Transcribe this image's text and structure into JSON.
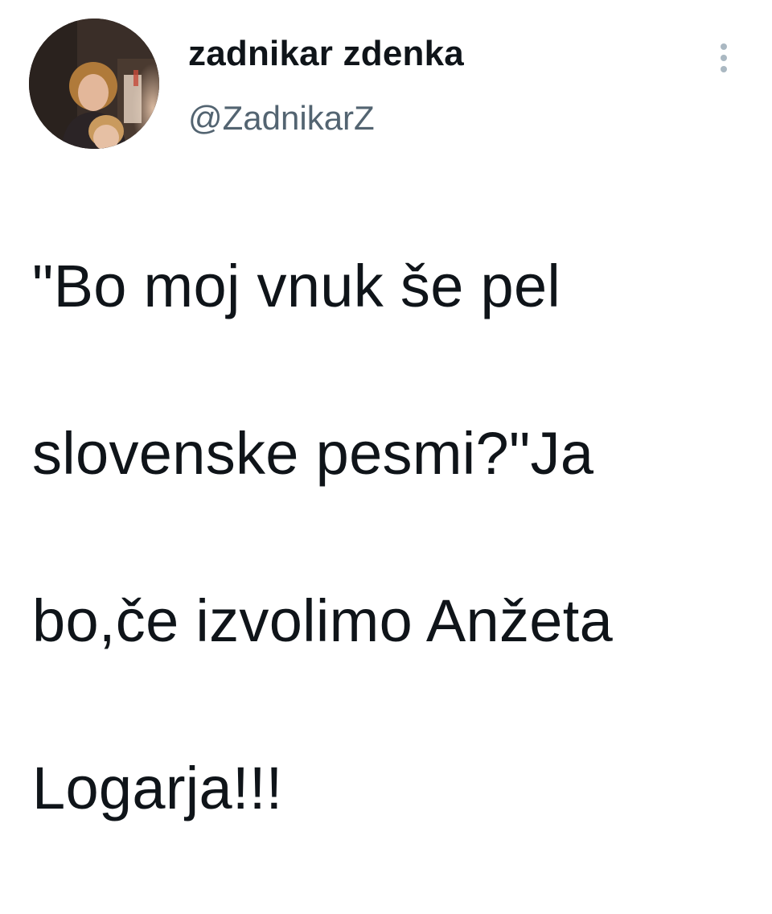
{
  "tweet": {
    "author": {
      "display_name": "zadnikar zdenka",
      "handle": "@ZadnikarZ",
      "avatar": "profile-photo"
    },
    "more_icon": "more-vertical-icon",
    "text_lines": [
      "\"Bo moj vnuk še pel",
      "slovenske pesmi?\"Ja",
      "bo,če izvolimo Anžeta",
      "Logarja!!!"
    ]
  },
  "colors": {
    "text": "#0f1419",
    "secondary_text": "#536471",
    "icon": "#aab8c2",
    "background": "#ffffff"
  }
}
